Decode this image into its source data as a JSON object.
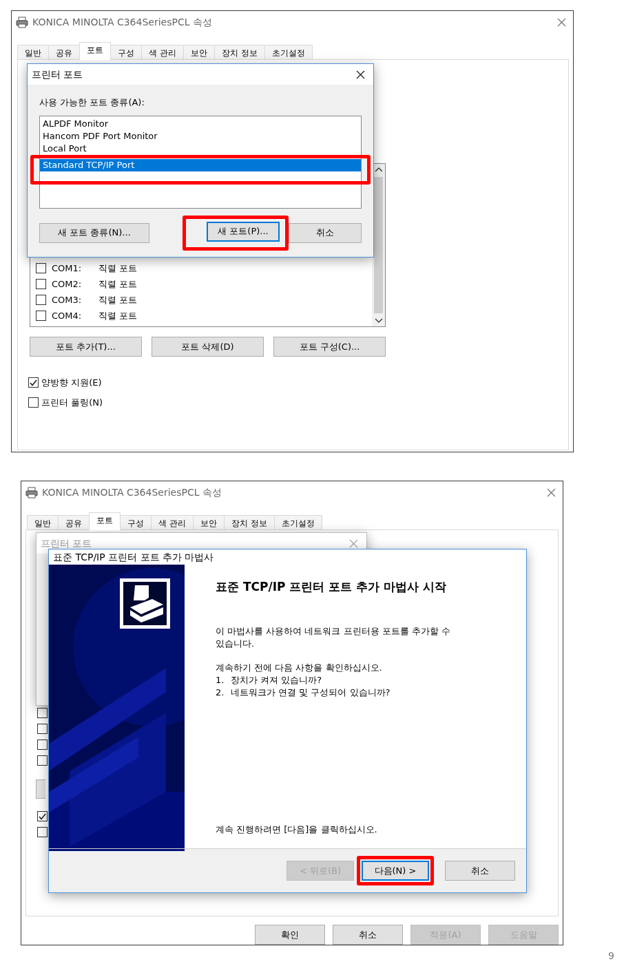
{
  "screenshot_1": {
    "window": {
      "title": "KONICA MINOLTA C364SeriesPCL 속성",
      "tabs": [
        {
          "label": "일반",
          "selected": false
        },
        {
          "label": "공유",
          "selected": false
        },
        {
          "label": "포트",
          "selected": true
        },
        {
          "label": "구성",
          "selected": false
        },
        {
          "label": "색 관리",
          "selected": false
        },
        {
          "label": "보안",
          "selected": false
        },
        {
          "label": "장치 정보",
          "selected": false
        },
        {
          "label": "초기설정",
          "selected": false
        }
      ],
      "ports": [
        {
          "checked": false,
          "port": "COM1:",
          "description": "직렬 포트"
        },
        {
          "checked": false,
          "port": "COM2:",
          "description": "직렬 포트"
        },
        {
          "checked": false,
          "port": "COM3:",
          "description": "직렬 포트"
        },
        {
          "checked": false,
          "port": "COM4:",
          "description": "직렬 포트"
        }
      ],
      "port_buttons": [
        "포트 추가(T)...",
        "포트 삭제(D)",
        "포트 구성(C)..."
      ],
      "options": [
        {
          "label": "양방향 지원(E)",
          "checked": true
        },
        {
          "label": "프린터 풀링(N)",
          "checked": false
        }
      ]
    },
    "dialog": {
      "title": "프린터 포트",
      "list_label": "사용 가능한 포트 종류(A):",
      "port_types": [
        {
          "label": "ALPDF Monitor",
          "selected": false,
          "highlighted": false
        },
        {
          "label": "Hancom PDF Port Monitor",
          "selected": false,
          "highlighted": false
        },
        {
          "label": "Local Port",
          "selected": false,
          "highlighted": false
        },
        {
          "label": "Standard TCP/IP Port",
          "selected": true,
          "highlighted": true
        }
      ],
      "buttons": [
        {
          "label": "새 포트 종류(N)...",
          "focused": false,
          "highlighted": false
        },
        {
          "label": "새 포트(P)...",
          "focused": true,
          "highlighted": true
        },
        {
          "label": "취소",
          "focused": false,
          "highlighted": false
        }
      ]
    }
  },
  "screenshot_2": {
    "window": {
      "title": "KONICA MINOLTA C364SeriesPCL 속성",
      "tabs": [
        {
          "label": "일반",
          "selected": false
        },
        {
          "label": "공유",
          "selected": false
        },
        {
          "label": "포트",
          "selected": true
        },
        {
          "label": "구성",
          "selected": false
        },
        {
          "label": "색 관리",
          "selected": false
        },
        {
          "label": "보안",
          "selected": false
        },
        {
          "label": "장치 정보",
          "selected": false
        },
        {
          "label": "초기설정",
          "selected": false
        }
      ],
      "port_checkboxes": [
        {
          "checked": false
        },
        {
          "checked": false
        },
        {
          "checked": false
        },
        {
          "checked": false
        }
      ],
      "option_checkboxes": [
        {
          "checked": true
        },
        {
          "checked": false
        }
      ],
      "buttons": [
        {
          "label": "확인",
          "disabled": false
        },
        {
          "label": "취소",
          "disabled": false
        },
        {
          "label": "적용(A)",
          "disabled": true
        },
        {
          "label": "도움말",
          "disabled": true
        }
      ]
    },
    "back_dialog": {
      "title": "프린터 포트"
    },
    "wizard": {
      "title": "표준 TCP/IP 프린터 포트 추가 마법사",
      "heading": "표준 TCP/IP 프린터 포트 추가 마법사 시작",
      "intro": "이 마법사를 사용하여 네트워크 프린터용 포트를 추가할 수 있습니다.",
      "checklist_title": "계속하기 전에 다음 사항을 확인하십시오.",
      "checklist": [
        {
          "number": "1.",
          "text": "장치가 켜져 있습니까?"
        },
        {
          "number": "2.",
          "text": "네트워크가 연결 및 구성되어 있습니까?"
        }
      ],
      "footer_text": "계속 진행하려면 [다음]을 클릭하십시오.",
      "buttons": [
        {
          "label": "< 뒤로(B)",
          "disabled": true,
          "focused": false,
          "highlighted": false
        },
        {
          "label": "다음(N) >",
          "disabled": false,
          "focused": true,
          "highlighted": true
        },
        {
          "label": "취소",
          "disabled": false,
          "focused": false,
          "highlighted": false
        }
      ]
    }
  },
  "page_number": "9"
}
